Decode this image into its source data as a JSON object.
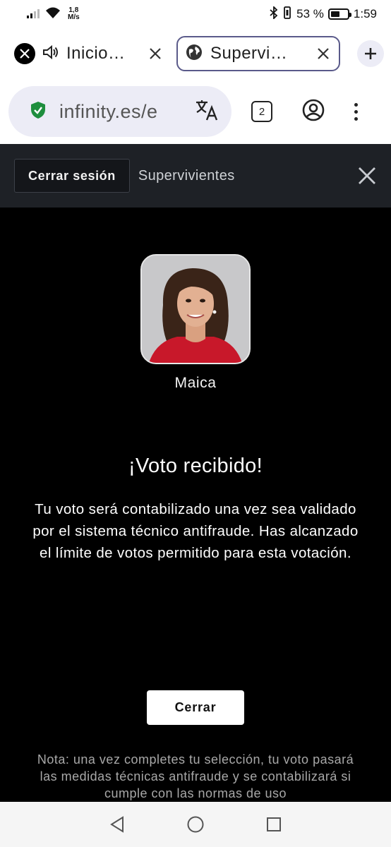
{
  "status_bar": {
    "speed_value": "1,8",
    "speed_unit": "M/s",
    "battery_percent": "53 %",
    "battery_level": 0.53,
    "time": "1:59"
  },
  "tabs": [
    {
      "title": "Inicio…",
      "icon": "x-logo-icon",
      "audio": true,
      "active": false
    },
    {
      "title": "Supervi…",
      "icon": "globe-icon",
      "audio": false,
      "active": true
    }
  ],
  "omnibox": {
    "url": "infinity.es/e",
    "tab_count": "2"
  },
  "site_header": {
    "logout_label": "Cerrar sesión",
    "title": "Supervivientes"
  },
  "content": {
    "candidate_name": "Maica",
    "vote_title": "¡Voto recibido!",
    "vote_message": "Tu voto será contabilizado una vez sea validado por el sistema técnico antifraude. Has alcanzado el límite de votos permitido para esta votación.",
    "close_label": "Cerrar",
    "note": "Nota: una vez completes tu selección, tu voto pasará las medidas técnicas antifraude y se contabilizará si cumple con las normas de uso"
  },
  "colors": {
    "header_bg": "#1e2126",
    "content_bg": "#000000",
    "omnibox_bg": "#ececf6",
    "secure_green": "#1e8e3e"
  }
}
